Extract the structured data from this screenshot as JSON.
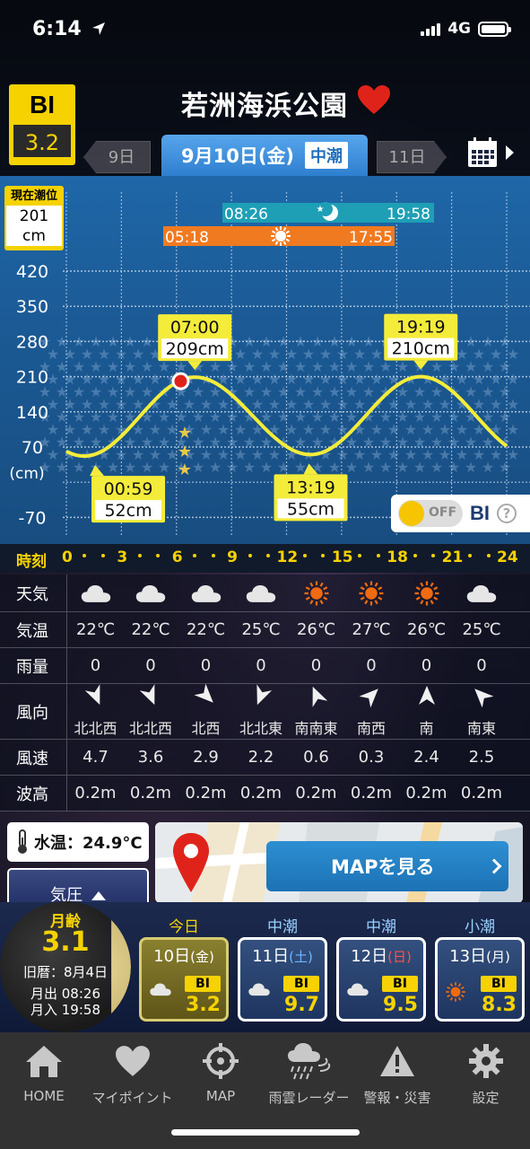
{
  "status": {
    "time": "6:14",
    "network": "4G"
  },
  "header": {
    "bi_label": "BI",
    "bi_value": "3.2",
    "place": "若洲海浜公園"
  },
  "date_nav": {
    "prev": "9日",
    "current": "9月10日(金)",
    "tide_type": "中潮",
    "next": "11日"
  },
  "tide_now": {
    "label": "現在潮位",
    "value": "201",
    "unit": "cm"
  },
  "moon_bar": {
    "rise": "08:26",
    "set": "19:58"
  },
  "sun_bar": {
    "rise": "05:18",
    "set": "17:55"
  },
  "chart_data": {
    "type": "line",
    "ylabel": "(cm)",
    "y_ticks": [
      420,
      350,
      280,
      210,
      140,
      70,
      -70
    ],
    "ylim": [
      -100,
      470
    ],
    "xlim": [
      0,
      24
    ],
    "x_ticks": [
      0,
      3,
      6,
      9,
      12,
      15,
      18,
      21,
      24
    ],
    "series": [
      {
        "x": [
          0,
          0.98,
          7.0,
          13.32,
          19.32,
          24
        ],
        "y": [
          70,
          52,
          209,
          55,
          210,
          70
        ]
      }
    ],
    "current_point": {
      "x": 6.23,
      "y": 201
    },
    "annotations": [
      {
        "time": "07:00",
        "height": "209cm",
        "x": 7.0,
        "y": 209,
        "pos": "above"
      },
      {
        "time": "19:19",
        "height": "210cm",
        "x": 19.32,
        "y": 210,
        "pos": "above"
      },
      {
        "time": "00:59",
        "height": "52cm",
        "x": 0.98,
        "y": 52,
        "pos": "below"
      },
      {
        "time": "13:19",
        "height": "55cm",
        "x": 13.32,
        "y": 55,
        "pos": "below"
      }
    ]
  },
  "bi_toggle": {
    "state": "OFF",
    "label": "BI",
    "help": "?"
  },
  "time_row": {
    "label": "時刻",
    "hours": [
      "0",
      "3",
      "6",
      "9",
      "12",
      "15",
      "18",
      "21",
      "24"
    ]
  },
  "weather": {
    "headers": {
      "sky": "天気",
      "temp": "気温",
      "rain": "雨量",
      "wind_dir": "風向",
      "wind_speed": "風速",
      "wave": "波高"
    },
    "cols": [
      {
        "sky": "cloud",
        "temp": "22℃",
        "rain": "0",
        "dir": "北北西",
        "deg": 337,
        "speed": "4.7",
        "wave": "0.2m"
      },
      {
        "sky": "cloud",
        "temp": "22℃",
        "rain": "0",
        "dir": "北北西",
        "deg": 337,
        "speed": "3.6",
        "wave": "0.2m"
      },
      {
        "sky": "cloud",
        "temp": "22℃",
        "rain": "0",
        "dir": "北西",
        "deg": 315,
        "speed": "2.9",
        "wave": "0.2m"
      },
      {
        "sky": "cloud",
        "temp": "25℃",
        "rain": "0",
        "dir": "北北東",
        "deg": 22,
        "speed": "2.2",
        "wave": "0.2m"
      },
      {
        "sky": "sun",
        "temp": "26℃",
        "rain": "0",
        "dir": "南南東",
        "deg": 157,
        "speed": "0.6",
        "wave": "0.2m"
      },
      {
        "sky": "sun",
        "temp": "27℃",
        "rain": "0",
        "dir": "南西",
        "deg": 225,
        "speed": "0.3",
        "wave": "0.2m"
      },
      {
        "sky": "sun",
        "temp": "26℃",
        "rain": "0",
        "dir": "南",
        "deg": 180,
        "speed": "2.4",
        "wave": "0.2m"
      },
      {
        "sky": "cloud",
        "temp": "25℃",
        "rain": "0",
        "dir": "南東",
        "deg": 135,
        "speed": "2.5",
        "wave": "0.2m"
      }
    ]
  },
  "water_temp": {
    "label": "水温：24.9°C"
  },
  "pressure": {
    "label": "気圧"
  },
  "map": {
    "label": "MAPを見る"
  },
  "moon": {
    "label": "月齢",
    "age": "3.1",
    "lunar_date": "旧暦：8月4日",
    "moonrise": "月出 08:26",
    "moonset": "月入 19:58"
  },
  "day_cards": [
    {
      "head": "今日",
      "date": "10日",
      "dow": "(金)",
      "dow_color": "#ffffff",
      "sky": "cloud",
      "bi": "3.2",
      "today": true
    },
    {
      "head": "中潮",
      "date": "11日",
      "dow": "(土)",
      "dow_color": "#6fb6ff",
      "sky": "cloud",
      "bi": "9.7",
      "today": false
    },
    {
      "head": "中潮",
      "date": "12日",
      "dow": "(日)",
      "dow_color": "#ff5050",
      "sky": "cloud",
      "bi": "9.5",
      "today": false
    },
    {
      "head": "小潮",
      "date": "13日",
      "dow": "(月)",
      "dow_color": "#ffffff",
      "sky": "sun",
      "bi": "8.3",
      "today": false
    }
  ],
  "tabs": [
    {
      "label": "HOME",
      "icon": "home-icon"
    },
    {
      "label": "マイポイント",
      "icon": "heart-icon"
    },
    {
      "label": "MAP",
      "icon": "crosshair-icon"
    },
    {
      "label": "雨雲レーダー",
      "icon": "rain-cloud-icon"
    },
    {
      "label": "警報・災害",
      "icon": "warning-icon"
    },
    {
      "label": "設定",
      "icon": "gear-icon"
    }
  ],
  "colors": {
    "accent": "#f6d200",
    "sky_blue": "#2f7fd0",
    "heart": "#e0231a",
    "sun_bar": "#f07a20",
    "moon_bar": "#1e9fb5"
  }
}
